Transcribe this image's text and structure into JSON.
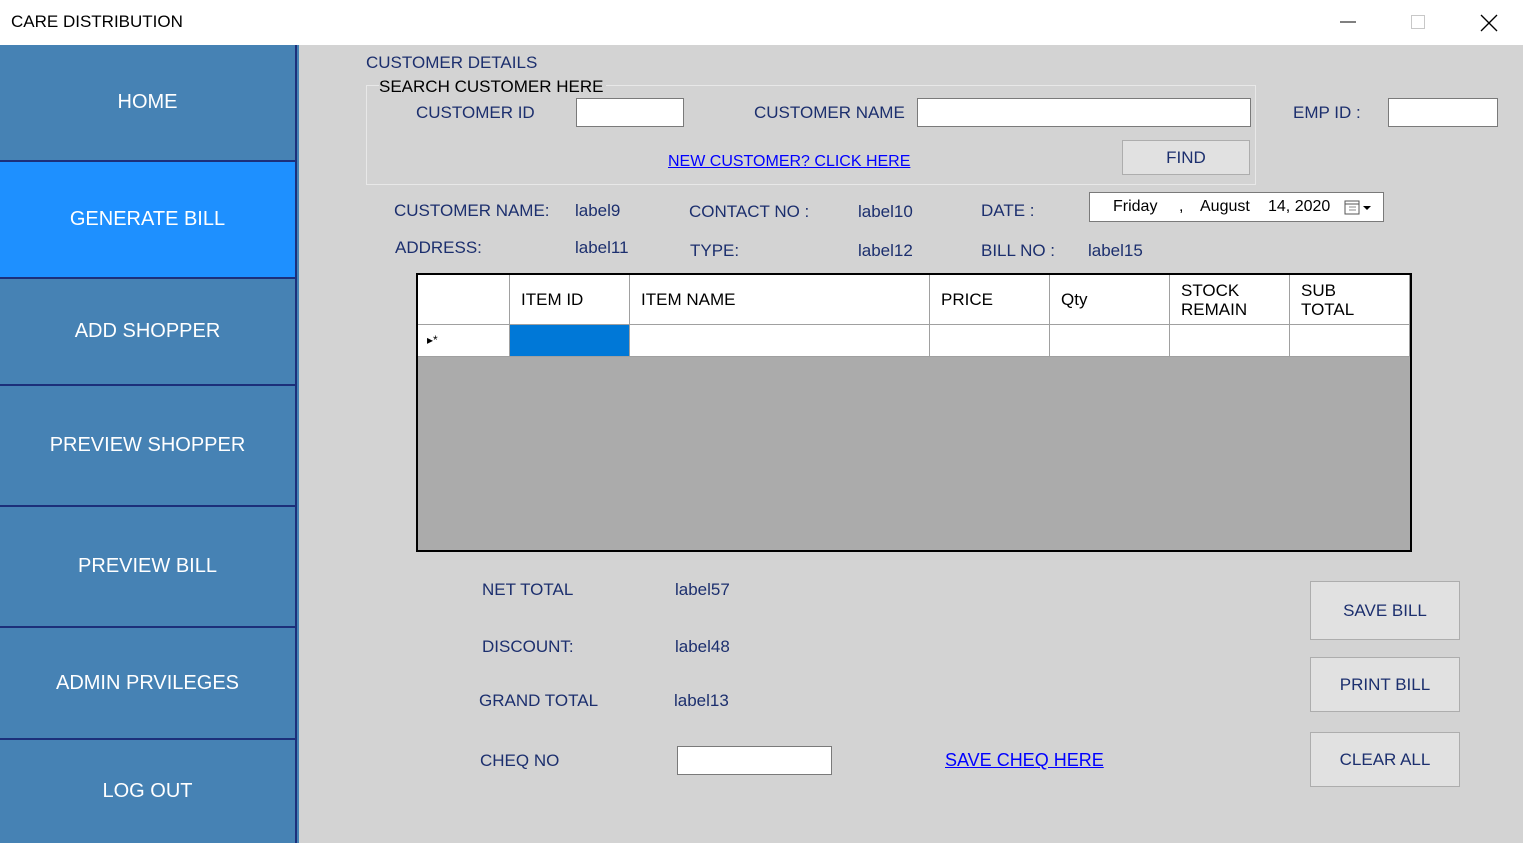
{
  "window": {
    "title": "CARE DISTRIBUTION"
  },
  "sidebar": {
    "items": [
      {
        "label": "HOME"
      },
      {
        "label": "GENERATE BILL"
      },
      {
        "label": "ADD SHOPPER"
      },
      {
        "label": "PREVIEW SHOPPER"
      },
      {
        "label": "PREVIEW BILL"
      },
      {
        "label": "ADMIN PRVILEGES"
      },
      {
        "label": "LOG OUT"
      }
    ],
    "active_index": 1
  },
  "customer": {
    "section_title": "CUSTOMER DETAILS",
    "search_group_title": "SEARCH CUSTOMER HERE",
    "customer_id_label": "CUSTOMER ID",
    "customer_id_value": "",
    "customer_name_label": "CUSTOMER NAME",
    "customer_name_value": "",
    "emp_id_label": "EMP ID :",
    "emp_id_value": "",
    "new_customer_link": "NEW CUSTOMER? CLICK HERE",
    "find_button": "FIND"
  },
  "info": {
    "customer_name_label": "CUSTOMER NAME:",
    "customer_name_value": "label9",
    "contact_label": "CONTACT NO :",
    "contact_value": "label10",
    "date_label": "DATE :",
    "date_day": "Friday",
    "date_sep": ",",
    "date_month": "August",
    "date_rest": "14, 2020",
    "address_label": "ADDRESS:",
    "address_value": "label11",
    "type_label": "TYPE:",
    "type_value": "label12",
    "bill_no_label": "BILL NO :",
    "bill_no_value": "label15"
  },
  "grid": {
    "columns": [
      {
        "line1": "",
        "line2": ""
      },
      {
        "line1": "ITEM ID",
        "line2": ""
      },
      {
        "line1": "ITEM NAME",
        "line2": ""
      },
      {
        "line1": "PRICE",
        "line2": ""
      },
      {
        "line1": "Qty",
        "line2": ""
      },
      {
        "line1": "STOCK",
        "line2": "REMAIN"
      },
      {
        "line1": "SUB",
        "line2": "TOTAL"
      }
    ],
    "new_row_marker": "▸*"
  },
  "totals": {
    "net_total_label": "NET TOTAL",
    "net_total_value": "label57",
    "discount_label": "DISCOUNT:",
    "discount_value": "label48",
    "grand_total_label": "GRAND TOTAL",
    "grand_total_value": "label13",
    "cheq_label": "CHEQ NO",
    "cheq_value": "",
    "save_cheq_link": "SAVE CHEQ HERE"
  },
  "actions": {
    "save_bill": "SAVE BILL",
    "print_bill": "PRINT BILL",
    "clear_all": "CLEAR ALL"
  },
  "colors": {
    "sidebar": "#4682b4",
    "sidebar_active": "#1e90ff",
    "main_bg": "#d3d3d3",
    "label_text": "#1c2f6e",
    "link": "#0000ff",
    "selected_cell": "#0078d7"
  }
}
